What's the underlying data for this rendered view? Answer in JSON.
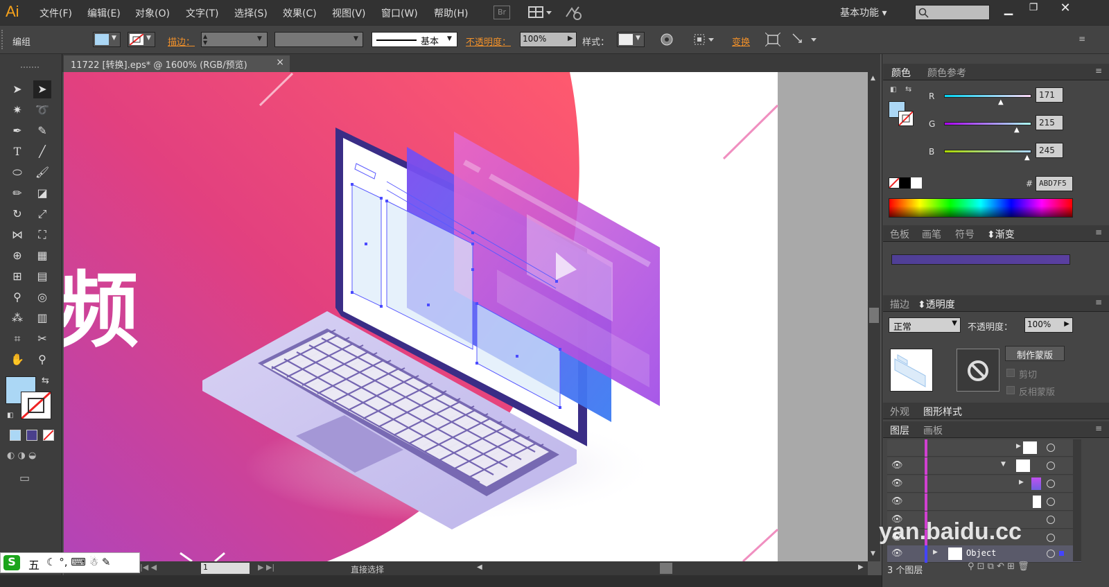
{
  "app": {
    "logo": "Ai",
    "workspace": "基本功能",
    "search_placeholder": ""
  },
  "menus": [
    "文件(F)",
    "编辑(E)",
    "对象(O)",
    "文字(T)",
    "选择(S)",
    "效果(C)",
    "视图(V)",
    "窗口(W)",
    "帮助(H)"
  ],
  "bridge": "Br",
  "control": {
    "group_label": "编组",
    "stroke_label": "描边：",
    "stroke_style": "基本",
    "opacity_label": "不透明度：",
    "opacity_value": "100%",
    "style_label": "样式：",
    "transform_label": "变换"
  },
  "document": {
    "tab_title": "11722 [转换].eps* @ 1600% (RGB/预览)",
    "close": "×",
    "artboard_text": "频"
  },
  "status": {
    "page": "1",
    "tool_label": "直接选择"
  },
  "color_panel": {
    "tabs": [
      "颜色",
      "颜色参考"
    ],
    "r_label": "R",
    "g_label": "G",
    "b_label": "B",
    "r": "171",
    "g": "215",
    "b": "245",
    "hash": "#",
    "hex": "ABD7F5",
    "fill_color": "#abd7f5"
  },
  "swatch_tabs": [
    "色板",
    "画笔",
    "符号",
    "渐变"
  ],
  "transparency": {
    "tabs": [
      "描边",
      "透明度"
    ],
    "blend_mode": "正常",
    "opacity_label": "不透明度：",
    "opacity_value": "100%",
    "make_mask": "制作蒙版",
    "clip": "剪切",
    "invert": "反相蒙版"
  },
  "appearance_tabs": [
    "外观",
    "图形样式"
  ],
  "layers": {
    "tabs": [
      "图层",
      "画板"
    ],
    "object_name": "Object",
    "count": "3 个图层"
  },
  "ime": {
    "label": "五"
  },
  "watermark": "yan.baidu.cc"
}
